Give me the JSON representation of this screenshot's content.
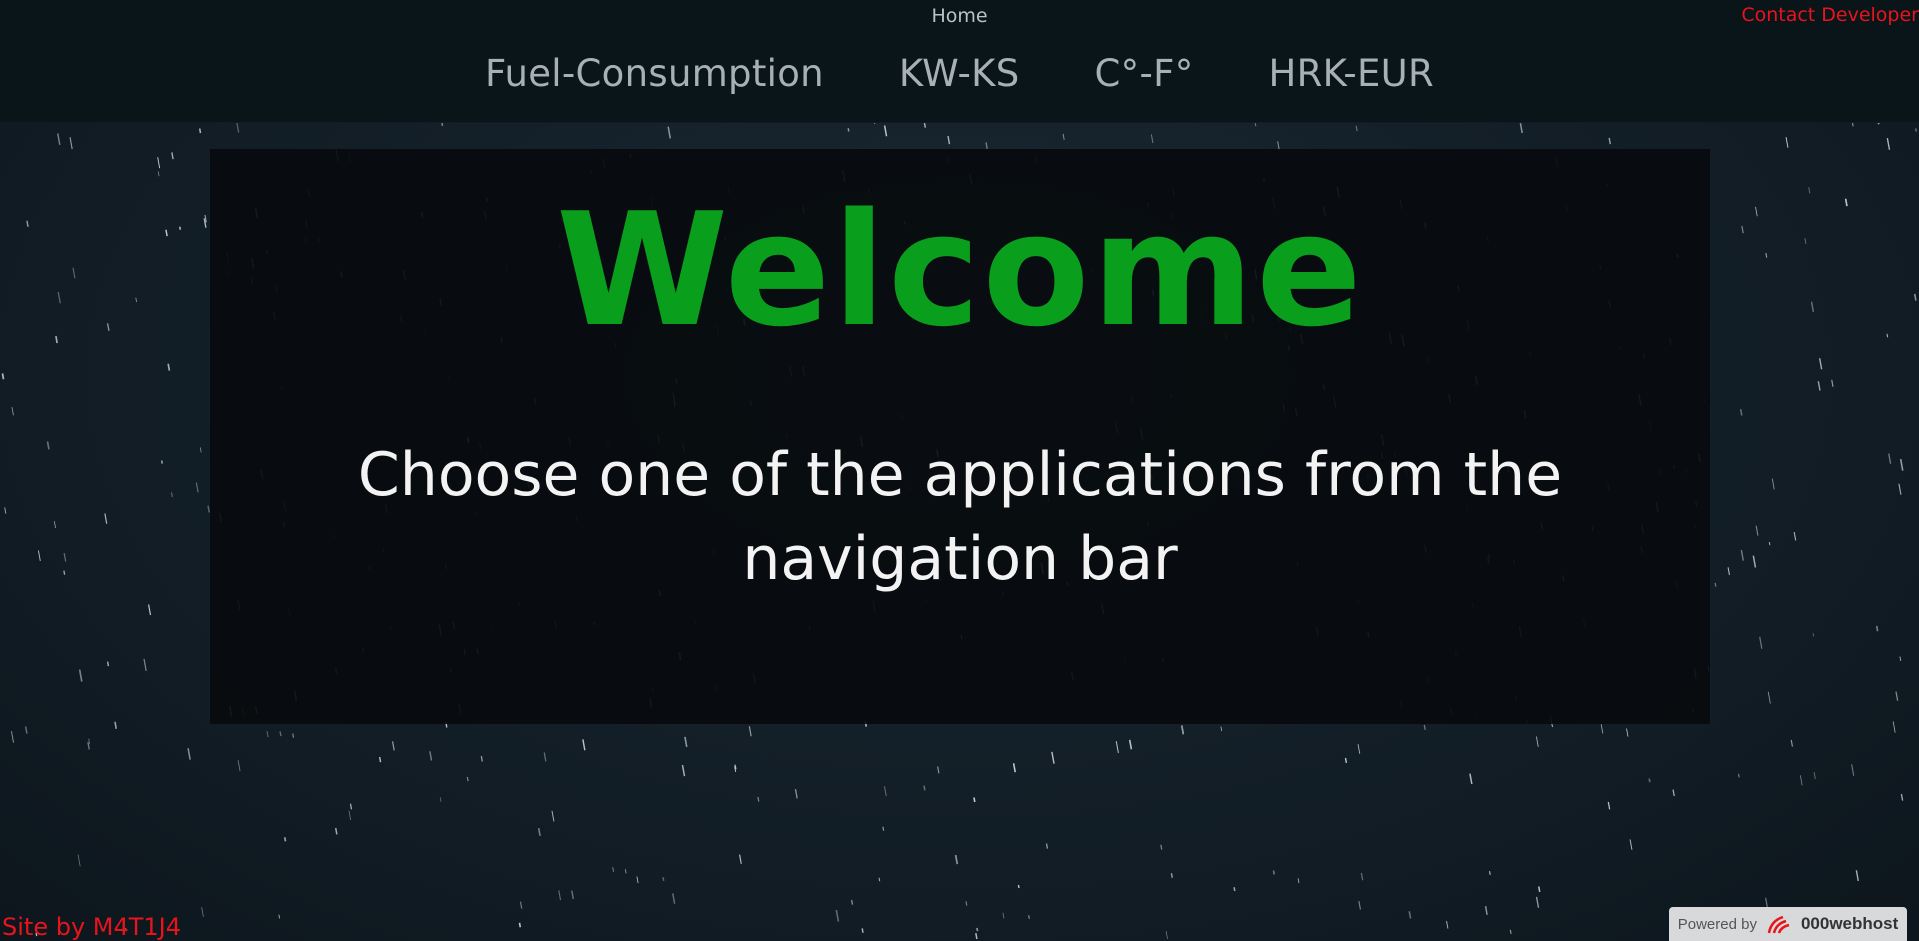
{
  "header": {
    "home_label": "Home",
    "contact_label": "Contact Developer",
    "nav_items": [
      {
        "label": "Fuel-Consumption"
      },
      {
        "label": "KW-KS"
      },
      {
        "label": "C°-F°"
      },
      {
        "label": "HRK-EUR"
      }
    ]
  },
  "main": {
    "title": "Welcome",
    "subtitle": "Choose one of the applications from the navigation bar"
  },
  "footer": {
    "credit": "Site by M4T1J4",
    "powered_label": "Powered by",
    "powered_brand": "000webhost"
  },
  "colors": {
    "accent_green": "#0a9e1d",
    "credit_red": "#e8141c",
    "header_bg": "#0a1519"
  },
  "icons": {
    "powered_logo": "webhost-logo-icon"
  }
}
